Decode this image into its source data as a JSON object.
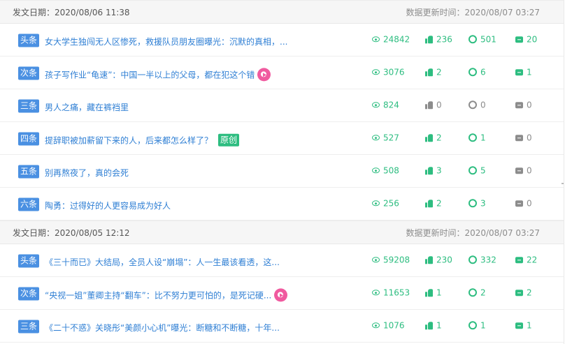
{
  "groups": [
    {
      "date_label": "发文日期：2020/08/06 11:38",
      "update_label": "数据更新时间：2020/08/07 03:27",
      "articles": [
        {
          "rank": "头条",
          "title": "女大学生独闯无人区惨死，救援队员朋友圈曝光：沉默的真相，...",
          "badge": "",
          "reads": "24842",
          "likes": "236",
          "watching": "501",
          "comments": "20",
          "likes_on": true,
          "watching_on": true,
          "comments_on": true
        },
        {
          "rank": "次条",
          "title": "孩子写作业“龟速”：中国一半以上的父母，都在犯这个错",
          "badge": "video",
          "reads": "3076",
          "likes": "2",
          "watching": "6",
          "comments": "1",
          "likes_on": true,
          "watching_on": true,
          "comments_on": true
        },
        {
          "rank": "三条",
          "title": "男人之痛，藏在裤裆里",
          "badge": "",
          "reads": "824",
          "likes": "0",
          "watching": "0",
          "comments": "0",
          "likes_on": false,
          "watching_on": false,
          "comments_on": false
        },
        {
          "rank": "四条",
          "title": "提辞职被加薪留下来的人，后来都怎么样了？",
          "badge": "原创",
          "reads": "527",
          "likes": "2",
          "watching": "1",
          "comments": "0",
          "likes_on": true,
          "watching_on": true,
          "comments_on": false
        },
        {
          "rank": "五条",
          "title": "别再熬夜了，真的会死",
          "badge": "",
          "reads": "508",
          "likes": "3",
          "watching": "5",
          "comments": "0",
          "likes_on": true,
          "watching_on": true,
          "comments_on": false
        },
        {
          "rank": "六条",
          "title": "陶勇：过得好的人更容易成为好人",
          "badge": "",
          "reads": "256",
          "likes": "2",
          "watching": "3",
          "comments": "0",
          "likes_on": true,
          "watching_on": true,
          "comments_on": false
        }
      ]
    },
    {
      "date_label": "发文日期：2020/08/05 12:12",
      "update_label": "数据更新时间：2020/08/07 03:27",
      "articles": [
        {
          "rank": "头条",
          "title": "《三十而已》大结局，全员人设“崩塌”：人一生最该看透，这...",
          "badge": "",
          "reads": "59208",
          "likes": "230",
          "watching": "332",
          "comments": "22",
          "likes_on": true,
          "watching_on": true,
          "comments_on": true
        },
        {
          "rank": "次条",
          "title": "“央视一姐”董卿主持“翻车”：比不努力更可怕的，是死记硬...",
          "badge": "video",
          "reads": "11653",
          "likes": "1",
          "watching": "2",
          "comments": "2",
          "likes_on": true,
          "watching_on": true,
          "comments_on": true
        },
        {
          "rank": "三条",
          "title": "《二十不惑》关晓彤“美颜小心机”曝光：断糖和不断糖，十年...",
          "badge": "",
          "reads": "1076",
          "likes": "1",
          "watching": "1",
          "comments": "1",
          "likes_on": true,
          "watching_on": true,
          "comments_on": true
        }
      ]
    }
  ],
  "icons": {
    "reads": "eye-icon",
    "likes": "thumbs-up-icon",
    "watching": "wow-gear-icon",
    "comments": "comment-icon",
    "video": "video-play-icon"
  },
  "colors": {
    "active": "#2dbd80",
    "inactive": "#8c8c8c",
    "rank_badge": "#4a90e2",
    "title_link": "#2f7fd4",
    "video_badge": "#f05a9f"
  }
}
